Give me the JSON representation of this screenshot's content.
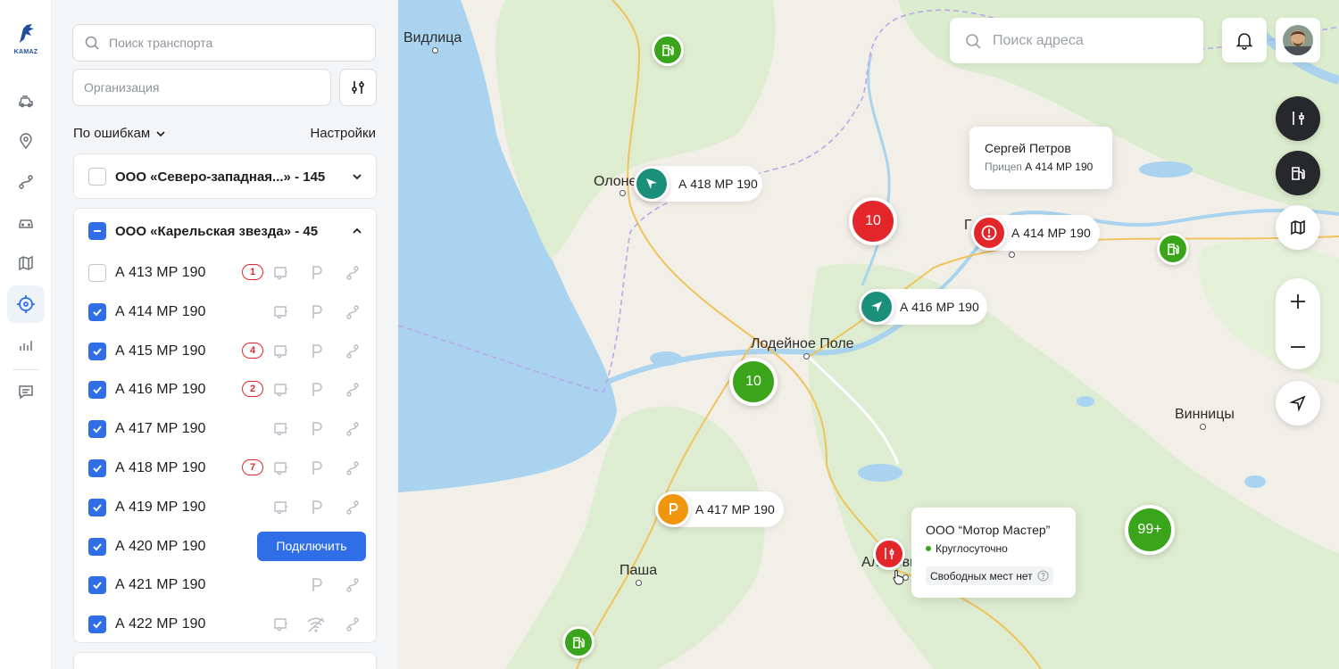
{
  "brand": {
    "logo_text": "KAMAZ"
  },
  "rail": {
    "items": [
      {
        "icon": "truck-icon"
      },
      {
        "icon": "location-pin-icon"
      },
      {
        "icon": "route-icon"
      },
      {
        "icon": "car-icon"
      },
      {
        "icon": "map-icon"
      },
      {
        "icon": "target-icon",
        "active": true
      },
      {
        "icon": "bar-chart-icon"
      },
      {
        "icon": "message-icon"
      }
    ]
  },
  "panel": {
    "search_placeholder": "Поиск транспорта",
    "org_placeholder": "Организация",
    "sort_label": "По ошибкам",
    "settings_label": "Настройки",
    "groups": [
      {
        "title": "ООО «Северо-западная...» - 145",
        "checked": false,
        "expanded": false
      },
      {
        "title": "ООО «Карельская звезда» - 45",
        "checked": "partial",
        "expanded": true
      }
    ],
    "vehicles": [
      {
        "plate": "А 413 МР 190",
        "checked": false,
        "errors": "1"
      },
      {
        "plate": "А 414 МР 190",
        "checked": true,
        "errors": ""
      },
      {
        "plate": "А 415 МР 190",
        "checked": true,
        "errors": "4"
      },
      {
        "plate": "А 416 МР 190",
        "checked": true,
        "errors": "2"
      },
      {
        "plate": "А 417 МР 190",
        "checked": true,
        "errors": ""
      },
      {
        "plate": "А 418 МР 190",
        "checked": true,
        "errors": "7"
      },
      {
        "plate": "А 419 МР 190",
        "checked": true,
        "errors": ""
      },
      {
        "plate": "А 420 МР 190",
        "checked": true,
        "errors": "",
        "action": "Подключить"
      },
      {
        "plate": "А 421 МР 190",
        "checked": true,
        "errors": ""
      },
      {
        "plate": "А 422 МР 190",
        "checked": true,
        "errors": ""
      }
    ]
  },
  "map": {
    "search_placeholder": "Поиск адреса",
    "towns": [
      "Видлица",
      "Олонец",
      "Лодейное Поле",
      "Винницы",
      "Паша",
      "Алёховщина",
      "Г"
    ],
    "vehicle_pins": [
      {
        "plate": "А 418 МР 190",
        "status": "moving",
        "color": "#1a8f7a"
      },
      {
        "plate": "А 414 МР 190",
        "status": "error",
        "color": "#e3262a"
      },
      {
        "plate": "А 416 МР 190",
        "status": "moving",
        "color": "#1a8f7a"
      },
      {
        "plate": "А 417 МР 190",
        "status": "parked",
        "color": "#f0960e"
      }
    ],
    "clusters": [
      {
        "label": "10",
        "color": "#e3262a"
      },
      {
        "label": "10",
        "color": "#3aa51b"
      },
      {
        "label": "99+",
        "color": "#3aa51b"
      }
    ],
    "driver_tooltip": {
      "name": "Сергей Петров",
      "trailer_label": "Прицеп",
      "trailer_plate": "А 414 МР 190"
    },
    "service_tooltip": {
      "name": "ООО “Мотор Мастер”",
      "hours": "Круглосуточно",
      "slots": "Свободных мест нет"
    }
  },
  "colors": {
    "accent": "#2f6ee6",
    "error": "#e3262a",
    "ok": "#3aa51b",
    "moving": "#1a8f7a",
    "parked": "#f0960e",
    "water": "#a9d3ee"
  }
}
